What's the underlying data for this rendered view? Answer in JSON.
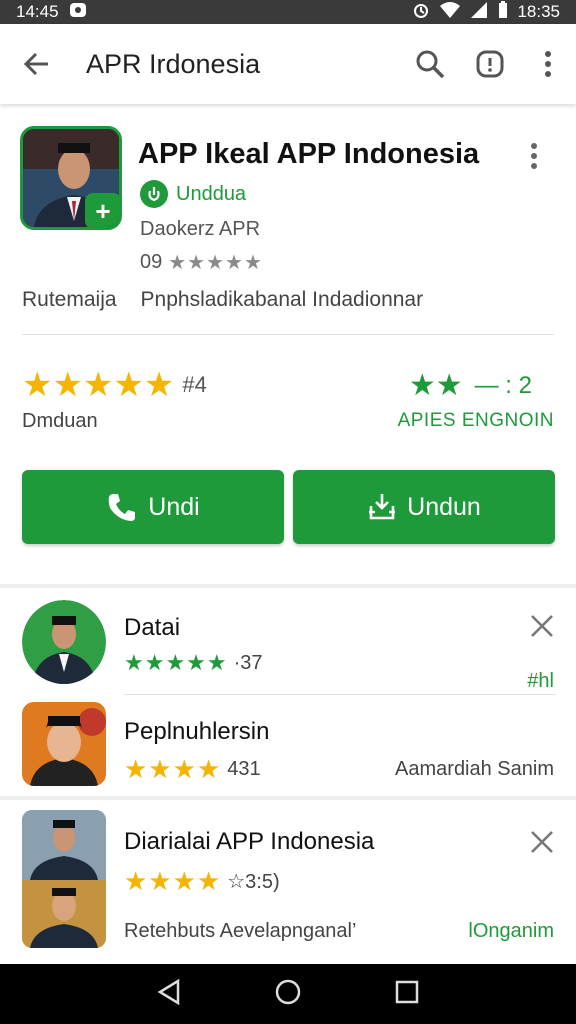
{
  "status_bar": {
    "left_time": "14:45",
    "right_time": "18:35"
  },
  "app_bar": {
    "title": "APR Irdonesia",
    "icons": [
      "back-arrow-icon",
      "search-icon",
      "info-icon",
      "more-vertical-icon"
    ]
  },
  "app_header": {
    "title": "APP Ikeal APP Indonesia",
    "developer_label": "Unddua",
    "sub1": "Daokerz APR",
    "rating_prefix": "09",
    "stars_gray": "★★★★★",
    "meta_left": "Rutemaija",
    "meta_right": "Pnphsladikabanal Indadionnar"
  },
  "ratings": {
    "left_stars": "★★★★★",
    "left_count": "#4",
    "left_sub": "Dmduan",
    "right_stars": "★★",
    "right_value": "— : 2",
    "right_sub": "APIES  ENGNOIN"
  },
  "buttons": {
    "primary_label": "Undi",
    "secondary_label": "Undun"
  },
  "list": [
    {
      "title": "Datai",
      "stars": "★★★★★",
      "score": "·37",
      "right_text": "#hl",
      "has_close": true
    },
    {
      "title": "Peplnuhlersin",
      "stars": "★★★★",
      "score": "431",
      "right_text": "Aamardiah Sanim",
      "has_close": false
    },
    {
      "title": "Diarialai APP Indonesia",
      "stars": "★★★★",
      "score": "☆3:5)",
      "subtitle": "Retehbuts  Aevelapnganal’",
      "right_text": "lOnganim",
      "has_close": true
    }
  ],
  "colors": {
    "brand_green": "#1f9a3a",
    "star_gold": "#f5b400",
    "status_bar": "#3a3a3a",
    "nav_bar": "#000000"
  }
}
